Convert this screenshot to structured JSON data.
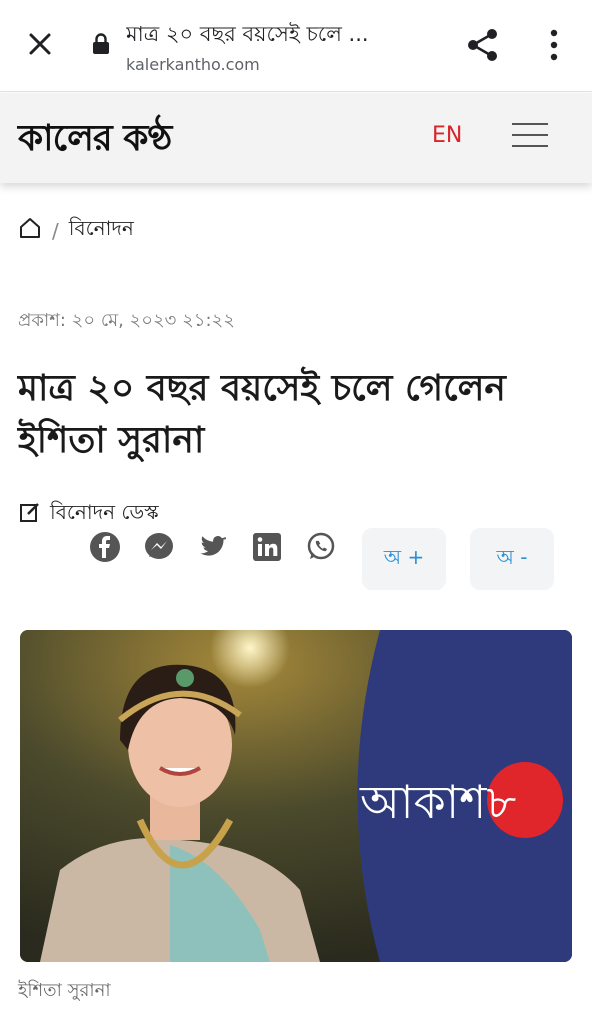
{
  "browser": {
    "page_title": "মাত্র ২০ বছর বয়সেই চলে ...",
    "url": "kalerkantho.com"
  },
  "site": {
    "logo_text": "কালের কণ্ঠ",
    "lang_label": "EN",
    "accent_color": "#d7262b"
  },
  "breadcrumb": {
    "separator": "/",
    "section": "বিনোদন"
  },
  "article": {
    "published": "প্রকাশ: ২০ মে, ২০২৩ ২১:২২",
    "headline": "মাত্র ২০ বছর বয়সেই চলে গেলেন ইশিতা সুরানা",
    "author": "বিনোদন ডেস্ক",
    "font_increase": "অ +",
    "font_decrease": "অ -",
    "image_caption": "ইশিতা সুরানা",
    "image_logo_text": "আকাশ৮"
  },
  "social_icons": [
    "facebook-icon",
    "messenger-icon",
    "twitter-icon",
    "linkedin-icon",
    "whatsapp-icon"
  ]
}
